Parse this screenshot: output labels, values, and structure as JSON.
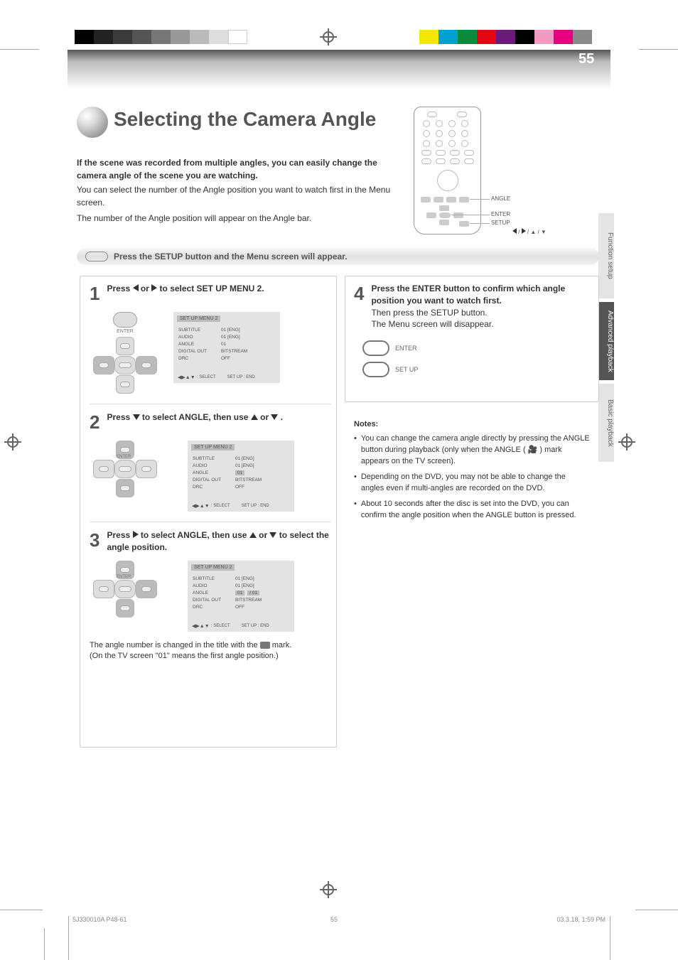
{
  "page_number": "55",
  "sidetabs": {
    "s1": "Function setup",
    "s2": "Advanced playback",
    "s3": "Basic playback"
  },
  "title": "Selecting the Camera Angle",
  "intro_bold": "If the scene was recorded from multiple angles, you can easily change the camera angle of the scene you are watching.",
  "intro_p1": "You can select the number of the Angle position you want to watch first in the Menu screen.",
  "intro_p2": "The number of the Angle position will appear on the Angle bar.",
  "remote_labels": {
    "angle": "ANGLE",
    "enter": "ENTER",
    "setup": "SETUP",
    "arrows": "◀ / ▶ / ▲ / ▼"
  },
  "band_text": "Press the SETUP button and the Menu screen will appear.",
  "step1": {
    "num": "1",
    "text_prefix": "Press ",
    "text_mid": " or ",
    "text_suffix": " to select SET UP MENU 2.",
    "tv": {
      "header": "SET UP MENU 2",
      "rows": [
        {
          "k": "SUBTITLE",
          "v": "01 [ENG]"
        },
        {
          "k": "AUDIO",
          "v": "01 [ENG]"
        },
        {
          "k": "ANGLE",
          "v": "01"
        },
        {
          "k": "DIGITAL OUT",
          "v": "BITSTREAM"
        },
        {
          "k": "DRC",
          "v": "OFF"
        }
      ],
      "foot_select": "SELECT",
      "foot_end": "SET UP : END"
    }
  },
  "step2": {
    "num": "2",
    "text_a": "Press ",
    "text_b": " to select ANGLE, then use ",
    "text_c": " or ",
    "text_d": " .",
    "tv": {
      "header": "SET UP MENU 2",
      "rows": [
        {
          "k": "SUBTITLE",
          "v": "01 [ENG]"
        },
        {
          "k": "AUDIO",
          "v": "01 [ENG]"
        },
        {
          "k": "ANGLE",
          "v": "01",
          "hi": true
        },
        {
          "k": "DIGITAL OUT",
          "v": "BITSTREAM"
        },
        {
          "k": "DRC",
          "v": "OFF"
        }
      ],
      "foot_select": "SELECT",
      "foot_end": "SET UP : END"
    }
  },
  "step3": {
    "num": "3",
    "text_a": "Press ",
    "text_b": " to select ANGLE, then use ",
    "text_c": " or ",
    "text_d": " to select the angle position.",
    "tv": {
      "header": "SET UP MENU 2",
      "rows": [
        {
          "k": "SUBTITLE",
          "v": "01 [ENG]"
        },
        {
          "k": "AUDIO",
          "v": "01 [ENG]"
        },
        {
          "k": "ANGLE",
          "v": "01",
          "hi": true,
          "v2": "/ 01",
          "hi2": true
        },
        {
          "k": "DIGITAL OUT",
          "v": "BITSTREAM"
        },
        {
          "k": "DRC",
          "v": "OFF"
        }
      ],
      "foot_select": "SELECT",
      "foot_end": "SET UP : END"
    },
    "note_prefix": "The angle number is changed in the title with the ",
    "note_suffix": " mark.",
    "note2": "(On the TV screen \"01\" means the first angle position.)"
  },
  "step4": {
    "num": "4",
    "line1_a": "Press the ENTER button to confirm which angle position you want to watch first.",
    "line2_a": "Then press the SETUP button.",
    "line2_b": "The Menu screen will disappear.",
    "enter_label": "ENTER",
    "setup_label": "SET UP"
  },
  "notes": {
    "header": "Notes:",
    "items": [
      "You can change the camera angle directly by pressing the ANGLE button during playback (only when the ANGLE ( 🎥 ) mark appears on the TV screen).",
      "Depending on the DVD, you may not be able to change the angles even if multi-angles are recorded on the DVD.",
      "About 10 seconds after the disc is set into the DVD, you can confirm the angle position when the ANGLE button is pressed."
    ]
  },
  "footer_left": "5J330010A  P48-61",
  "footer_right": "03.3.18, 1:59 PM",
  "footer_page": "55"
}
